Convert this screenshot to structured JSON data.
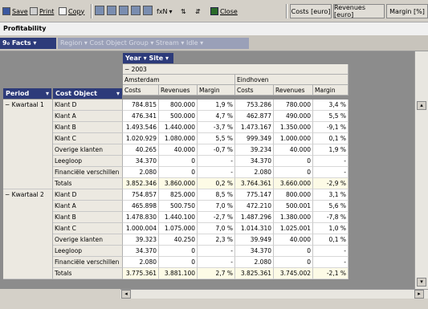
{
  "toolbar": {
    "save_label": "Save",
    "print_label": "Print",
    "copy_label": "Copy",
    "format_label": "fxN",
    "close_label": "Close",
    "column_buttons": [
      "Costs [euro]",
      "Revenues [euro]",
      "Margin [%]"
    ]
  },
  "report": {
    "title": "Profitability"
  },
  "filters": {
    "facts_label": "9₀ Facts",
    "dimensions": [
      "Region",
      "Cost Object Group",
      "Stream",
      "Idle"
    ]
  },
  "pivot": {
    "col_dims": [
      "Year",
      "Site"
    ],
    "year": "− 2003",
    "sites": [
      "Amsterdam",
      "Eindhoven"
    ],
    "measures": [
      "Costs",
      "Revenues",
      "Margin"
    ],
    "row_dims": [
      "Period",
      "Cost Object"
    ],
    "groups": [
      {
        "period": "− Kwartaal 1",
        "rows": [
          {
            "obj": "Klant D",
            "v": [
              "784.815",
              "800.000",
              "1,9 %",
              "753.286",
              "780.000",
              "3,4 %"
            ]
          },
          {
            "obj": "Klant A",
            "v": [
              "476.341",
              "500.000",
              "4,7 %",
              "462.877",
              "490.000",
              "5,5 %"
            ]
          },
          {
            "obj": "Klant B",
            "v": [
              "1.493.546",
              "1.440.000",
              "-3,7 %",
              "1.473.167",
              "1.350.000",
              "-9,1 %"
            ]
          },
          {
            "obj": "Klant C",
            "v": [
              "1.020.929",
              "1.080.000",
              "5,5 %",
              "999.349",
              "1.000.000",
              "0,1 %"
            ]
          },
          {
            "obj": "Overige klanten",
            "v": [
              "40.265",
              "40.000",
              "-0,7 %",
              "39.234",
              "40.000",
              "1,9 %"
            ]
          },
          {
            "obj": "Leegloop",
            "v": [
              "34.370",
              "0",
              "-",
              "34.370",
              "0",
              "-"
            ]
          },
          {
            "obj": "Financiële verschillen",
            "v": [
              "2.080",
              "0",
              "-",
              "2.080",
              "0",
              "-"
            ]
          },
          {
            "obj": "Totals",
            "v": [
              "3.852.346",
              "3.860.000",
              "0,2 %",
              "3.764.361",
              "3.660.000",
              "-2,9 %"
            ],
            "total": true
          }
        ]
      },
      {
        "period": "− Kwartaal 2",
        "rows": [
          {
            "obj": "Klant D",
            "v": [
              "754.857",
              "825.000",
              "8,5 %",
              "775.147",
              "800.000",
              "3,1 %"
            ]
          },
          {
            "obj": "Klant A",
            "v": [
              "465.898",
              "500.750",
              "7,0 %",
              "472.210",
              "500.001",
              "5,6 %"
            ]
          },
          {
            "obj": "Klant B",
            "v": [
              "1.478.830",
              "1.440.100",
              "-2,7 %",
              "1.487.296",
              "1.380.000",
              "-7,8 %"
            ]
          },
          {
            "obj": "Klant C",
            "v": [
              "1.000.004",
              "1.075.000",
              "7,0 %",
              "1.014.310",
              "1.025.001",
              "1,0 %"
            ]
          },
          {
            "obj": "Overige klanten",
            "v": [
              "39.323",
              "40.250",
              "2,3 %",
              "39.949",
              "40.000",
              "0,1 %"
            ]
          },
          {
            "obj": "Leegloop",
            "v": [
              "34.370",
              "0",
              "-",
              "34.370",
              "0",
              "-"
            ]
          },
          {
            "obj": "Financiële verschillen",
            "v": [
              "2.080",
              "0",
              "-",
              "2.080",
              "0",
              "-"
            ]
          },
          {
            "obj": "Totals",
            "v": [
              "3.775.361",
              "3.881.100",
              "2,7 %",
              "3.825.361",
              "3.745.002",
              "-2,1 %"
            ],
            "total": true
          }
        ]
      }
    ]
  },
  "colors": {
    "header_blue": "#2d3b7a",
    "totals_bg": "#fdfbe6",
    "grid_bg": "#8c8c8c"
  }
}
